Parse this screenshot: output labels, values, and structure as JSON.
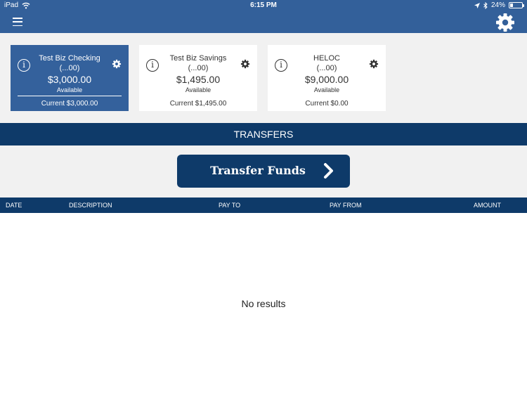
{
  "status_bar": {
    "device": "iPad",
    "time": "6:15 PM",
    "battery": "24%",
    "battery_level": 0.24
  },
  "nav": {
    "menu_icon": "hamburger-menu-icon",
    "settings_icon": "gear-icon"
  },
  "accounts": [
    {
      "name": "Test Biz Checking",
      "number": "(...00)",
      "balance": "$3,000.00",
      "available_label": "Available",
      "current": "Current $3,000.00",
      "selected": true
    },
    {
      "name": "Test Biz Savings",
      "number": "(...00)",
      "balance": "$1,495.00",
      "available_label": "Available",
      "current": "Current $1,495.00",
      "selected": false
    },
    {
      "name": "HELOC",
      "number": "(...00)",
      "balance": "$9,000.00",
      "available_label": "Available",
      "current": "Current $0.00",
      "selected": false
    }
  ],
  "section": {
    "title": "TRANSFERS"
  },
  "transfer_button": {
    "label": "Transfer Funds"
  },
  "table": {
    "columns": [
      "DATE",
      "DESCRIPTION",
      "PAY TO",
      "PAY FROM",
      "AMOUNT"
    ],
    "empty_message": "No results"
  },
  "colors": {
    "header_blue": "#33609a",
    "navy": "#0e3a69",
    "selected_card": "#34619c",
    "background_gray": "#f1f1f1"
  }
}
